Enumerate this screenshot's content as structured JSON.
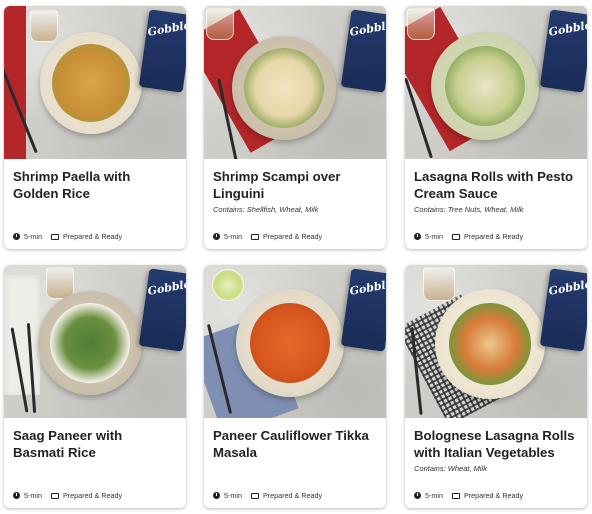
{
  "brand": "Gobble",
  "colors": {
    "package": "#1f3262",
    "napkin_red": "#b3262a",
    "card_text": "#222222"
  },
  "meals": [
    {
      "title": "Shrimp Paella with Golden Rice",
      "contains": "",
      "time": "5-min",
      "prep": "Prepared & Ready"
    },
    {
      "title": "Shrimp Scampi over Linguini",
      "contains": "Contains: Shellfish, Wheat, Milk",
      "time": "5-min",
      "prep": "Prepared & Ready"
    },
    {
      "title": "Lasagna Rolls with Pesto Cream Sauce",
      "contains": "Contains: Tree Nuts, Wheat, Milk",
      "time": "5-min",
      "prep": "Prepared & Ready"
    },
    {
      "title": "Saag Paneer with Basmati Rice",
      "contains": "",
      "time": "5-min",
      "prep": "Prepared & Ready"
    },
    {
      "title": "Paneer Cauliflower Tikka Masala",
      "contains": "",
      "time": "5-min",
      "prep": "Prepared & Ready"
    },
    {
      "title": "Bolognese Lasagna Rolls with Italian Vegetables",
      "contains": "Contains: Wheat, Milk",
      "time": "5-min",
      "prep": "Prepared & Ready"
    }
  ]
}
